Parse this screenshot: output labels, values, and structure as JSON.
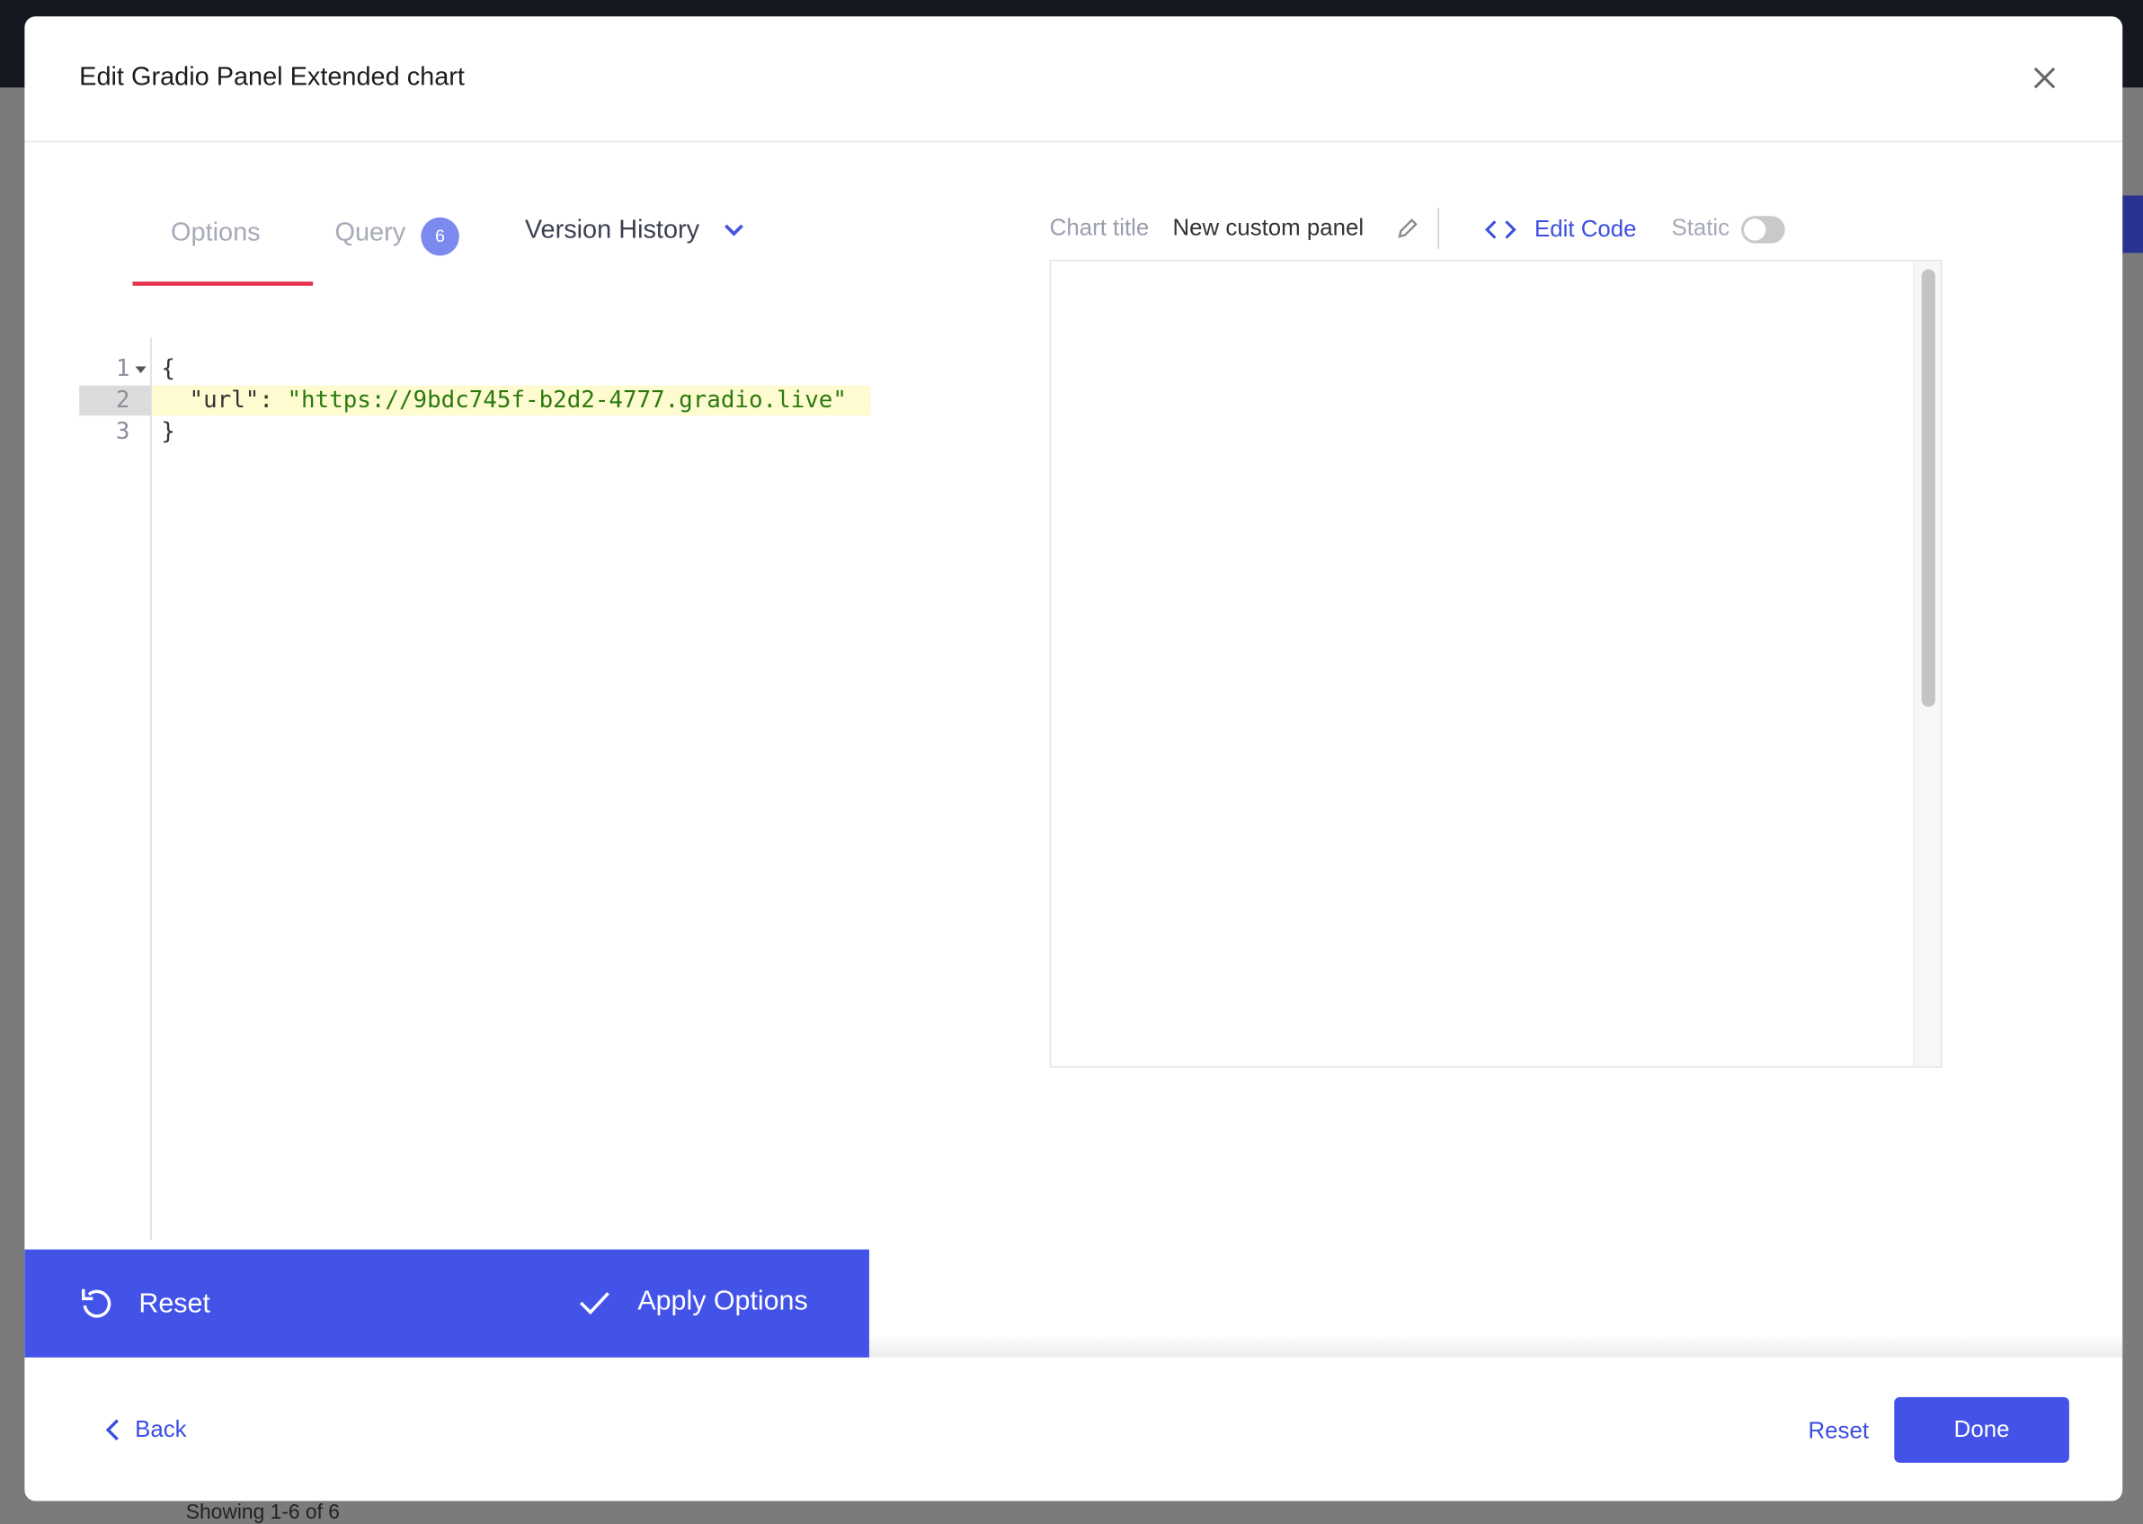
{
  "background": {
    "pagination_text": "Showing 1-6 of 6"
  },
  "modal": {
    "title": "Edit Gradio Panel Extended chart",
    "tabs": [
      {
        "label": "Options",
        "active": true
      },
      {
        "label": "Query",
        "badge": "6"
      }
    ],
    "version_history": "Version History",
    "editor": {
      "lines": [
        "{",
        "  \"url\": ",
        "\"https://9bdc745f-b2d2-4777.gradio.live\"",
        "}"
      ],
      "line_numbers": [
        "1",
        "2",
        "3"
      ]
    },
    "actions": {
      "reset": "Reset",
      "apply": "Apply Options"
    },
    "chart": {
      "title_label": "Chart title",
      "title_value": "New custom panel",
      "edit_code": "Edit Code",
      "static_label": "Static",
      "static_on": false
    },
    "footer": {
      "back": "Back",
      "reset": "Reset",
      "done": "Done"
    },
    "colors": {
      "accent": "#4353e8",
      "tab_underline": "#e5304e"
    }
  }
}
